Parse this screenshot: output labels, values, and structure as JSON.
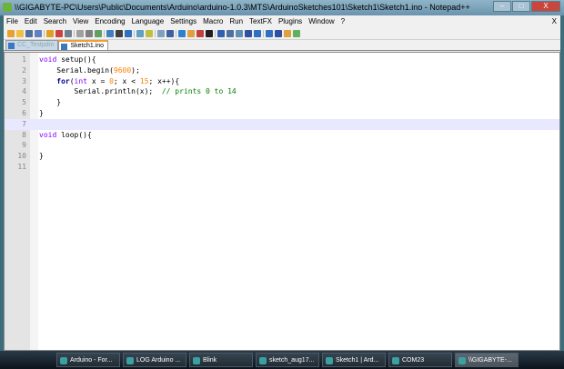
{
  "window": {
    "title": "\\\\GIGABYTE-PC\\Users\\Public\\Documents\\Arduino\\arduino-1.0.3\\MTS\\ArduinoSketches101\\Sketch1\\Sketch1.ino - Notepad++",
    "minimize": "–",
    "maximize": "□",
    "close": "X"
  },
  "menu": [
    "File",
    "Edit",
    "Search",
    "View",
    "Encoding",
    "Language",
    "Settings",
    "Macro",
    "Run",
    "TextFX",
    "Plugins",
    "Window",
    "?"
  ],
  "menu_close": "X",
  "tabs": [
    {
      "label": "CC_Testpdm"
    },
    {
      "label": "Sketch1.ino",
      "active": true
    }
  ],
  "editor": {
    "lines": [
      {
        "n": "1",
        "html": "<span class='ty'>void</span> setup(){"
      },
      {
        "n": "2",
        "html": "    Serial.begin(<span class='num'>9600</span>);"
      },
      {
        "n": "3",
        "html": "    <span class='kw'>for</span>(<span class='ty'>int</span> x = <span class='num'>0</span>; x &lt; <span class='num'>15</span>; x++){"
      },
      {
        "n": "4",
        "html": "        Serial.println(x);  <span class='cm'>// prints 0 to 14</span>"
      },
      {
        "n": "5",
        "html": "    }"
      },
      {
        "n": "6",
        "html": "}"
      },
      {
        "n": "7",
        "html": "",
        "current": true
      },
      {
        "n": "8",
        "html": "<span class='ty'>void</span> loop(){"
      },
      {
        "n": "9",
        "html": ""
      },
      {
        "n": "10",
        "html": "}"
      },
      {
        "n": "11",
        "html": ""
      }
    ]
  },
  "taskbar": [
    "Arduino - For...",
    "LOG Arduino ...",
    "Blink",
    "sketch_aug17...",
    "Sketch1 | Ard...",
    "COM23",
    "\\\\GIGABYTE-..."
  ],
  "colors": {
    "current_line": "#e8e8ff",
    "keyword": "#00008b",
    "number": "#ff8000",
    "comment": "#008000"
  }
}
